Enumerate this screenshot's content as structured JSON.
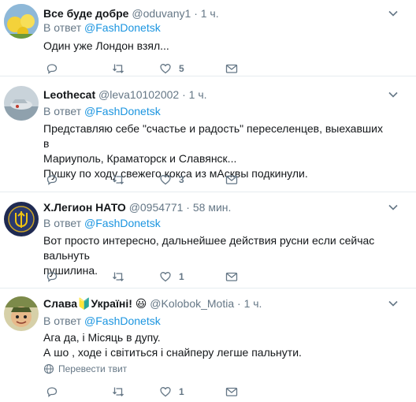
{
  "tweets": [
    {
      "name": "Все буде добре",
      "handle": "@oduvany1",
      "dot": "·",
      "time": "1 ч.",
      "reply_prefix": "В ответ",
      "reply_to": "@FashDonetsk",
      "text": "Один уже Лондон взял...",
      "replies": "",
      "retweets": "",
      "likes": "5"
    },
    {
      "name": "Leothecat",
      "handle": "@leva10102002",
      "dot": "·",
      "time": "1 ч.",
      "reply_prefix": "В ответ",
      "reply_to": "@FashDonetsk",
      "text_lines": [
        "Представляю себе \"счастье и радость\" переселенцев, выехавших в",
        "Мариуполь, Краматорск и Славянск...",
        "Пушку по ходу свежего кокса из мАсквы подкинули."
      ],
      "replies": "",
      "retweets": "",
      "likes": "3"
    },
    {
      "name": "Х.Легион НАТО",
      "handle": "@0954771",
      "dot": "·",
      "time": "58 мин.",
      "reply_prefix": "В ответ",
      "reply_to": "@FashDonetsk",
      "text_lines": [
        "Вот просто интересно, дальнейшее действия русни если сейчас вальнуть",
        "пушилина."
      ],
      "replies": "",
      "retweets": "",
      "likes": "1"
    },
    {
      "name_start": "Слава",
      "name_emoji": "🔰",
      "name_end": "Україні!",
      "name_emoji2": "😃",
      "handle": "@Kolobok_Motia",
      "dot": "·",
      "time": "1 ч.",
      "reply_prefix": "В ответ",
      "reply_to": "@FashDonetsk",
      "text_lines": [
        "Ага да, і Місяць в дупу.",
        "А шо , ходе і світиться і снайперу легше пальнути."
      ],
      "translate_label": "Перевести твит",
      "replies": "",
      "retweets": "",
      "likes": "1"
    }
  ],
  "icons": {
    "reply": "reply-icon",
    "retweet": "retweet-icon",
    "like": "heart-icon",
    "dm": "mail-icon",
    "caret": "chevron-down-icon",
    "translate": "globe-icon"
  },
  "colors": {
    "link": "#1b95e0",
    "muted": "#657786",
    "border": "#e6ecf0"
  }
}
